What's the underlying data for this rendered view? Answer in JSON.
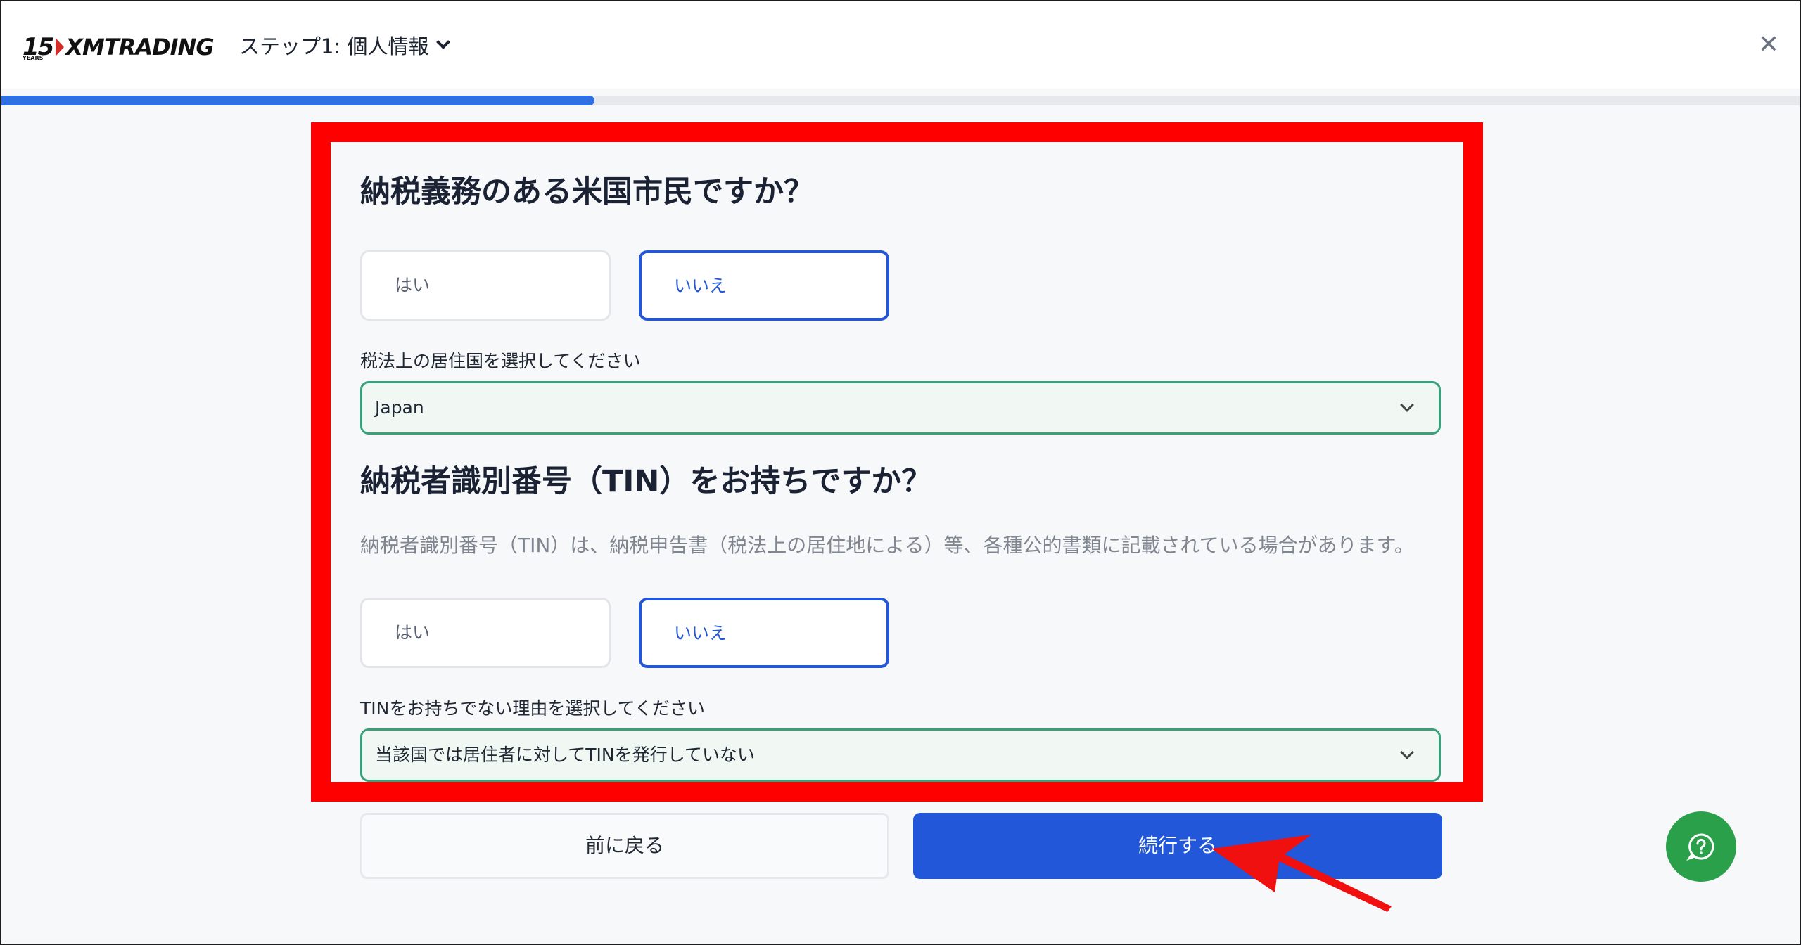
{
  "header": {
    "logo_number": "15",
    "logo_years": "YEARS",
    "logo_text": "XMTRADING",
    "step_title": "ステップ1: 個人情報",
    "close_icon": "close-icon"
  },
  "progress": {
    "fraction": 0.33
  },
  "section_us_citizen": {
    "question": "納税義務のある米国市民ですか？",
    "options": [
      "はい",
      "いいえ"
    ],
    "selected": "いいえ"
  },
  "tax_residence": {
    "label": "税法上の居住国を選択してください",
    "value": "Japan"
  },
  "section_tin": {
    "question": "納税者識別番号（TIN）をお持ちですか？",
    "note": "納税者識別番号（TIN）は、納税申告書（税法上の居住地による）等、各種公的書類に記載されている場合があります。",
    "options": [
      "はい",
      "いいえ"
    ],
    "selected": "いいえ"
  },
  "tin_reason": {
    "label": "TINをお持ちでない理由を選択してください",
    "value": "当該国では居住者に対してTINを発行していない"
  },
  "buttons": {
    "back_label": "前に戻る",
    "next_label": "続行する"
  },
  "colors": {
    "accent": "#2157d8",
    "highlight": "#ff0000",
    "select_border": "#3aa07a",
    "help_button": "#2aa04a"
  }
}
